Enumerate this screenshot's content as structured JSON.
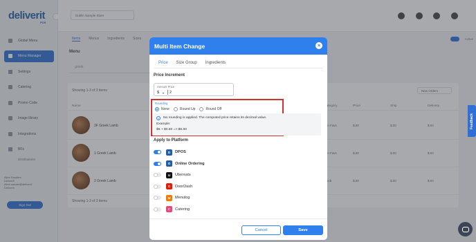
{
  "background": {
    "logo": "deliverit",
    "logo_sub": "POS",
    "store_select": "Dublin Sample Store",
    "nav": [
      {
        "label": "Global Menu",
        "icon": "globe-icon"
      },
      {
        "label": "Menu Manager",
        "icon": "menu-icon"
      },
      {
        "label": "Settings",
        "icon": "gear-icon"
      },
      {
        "label": "Catering",
        "icon": "catering-icon"
      },
      {
        "label": "Promo Code",
        "icon": "promo-icon"
      },
      {
        "label": "Image library",
        "icon": "image-icon"
      },
      {
        "label": "Integrations",
        "icon": "plug-icon"
      },
      {
        "label": "BFs",
        "icon": "report-icon"
      }
    ],
    "nav_sub": "Distributions",
    "account": [
      "Alice Sanders",
      "DeliverIt",
      "Alice.sander@deliverit",
      "DeliverIt"
    ],
    "signout": "Sign Out",
    "tabs": [
      "Items",
      "Menus",
      "Ingredients",
      "Sizes"
    ],
    "toggle_label": "Active",
    "menu_title": "Menu",
    "search_value": "greek",
    "showing_top": "Showing 1-3 of 3 items",
    "showing_bottom": "Showing 1-3 of 3 items",
    "ordering_select": "New Orders",
    "columns": [
      "Name",
      "Category",
      "Price",
      "Ship",
      "Delivery"
    ],
    "rows": [
      {
        "name": "3F Greek Lamb",
        "category": "Fan Favs",
        "price": "$.00",
        "ship": "$.00",
        "delivery": "$.00"
      },
      {
        "name": "1 Greek Lamb",
        "category": "Fan Favs",
        "price": "$.00",
        "ship": "$.00",
        "delivery": "$.00"
      },
      {
        "name": "2 Greek Lamb",
        "category": "Lamb",
        "price": "$.00",
        "ship": "$.00",
        "delivery": "$.00"
      }
    ]
  },
  "modal": {
    "title": "Multi Item Change",
    "close_icon": "close-icon",
    "tabs": [
      {
        "label": "Price",
        "active": true
      },
      {
        "label": "Size Group",
        "active": false
      },
      {
        "label": "Ingredients",
        "active": false
      }
    ],
    "price_increment_title": "Price Increment",
    "amount": {
      "label": "Amount Price",
      "currency": "$",
      "currency_caret": "▾",
      "value": "2"
    },
    "rounding": {
      "label": "Rounding",
      "options": [
        {
          "label": "None",
          "selected": true
        },
        {
          "label": "Round Up",
          "selected": false
        },
        {
          "label": "Round Off",
          "selected": false
        }
      ],
      "info_icon": "info-icon",
      "info_text": "No rounding is applied. The computed price retains its decimal value.",
      "example_label": "Example:",
      "example_value": "$6 + $0.60 => $6.60"
    },
    "apply_title": "Apply to Platform",
    "platforms": [
      {
        "name": "DPOS",
        "enabled": true,
        "icon": "dpos-icon",
        "color": "#1f5fa8",
        "glyph": "D"
      },
      {
        "name": "Online Ordering",
        "enabled": true,
        "icon": "online-ordering-icon",
        "color": "#1f5fa8",
        "glyph": "O"
      },
      {
        "name": "Ubereats",
        "enabled": false,
        "icon": "ubereats-icon",
        "color": "#111111",
        "glyph": "U"
      },
      {
        "name": "DoorDash",
        "enabled": false,
        "icon": "doordash-icon",
        "color": "#eb1700",
        "glyph": "D"
      },
      {
        "name": "Menulog",
        "enabled": false,
        "icon": "menulog-icon",
        "color": "#f27c00",
        "glyph": "M"
      },
      {
        "name": "Catering",
        "enabled": false,
        "icon": "catering-icon",
        "color": "#e8487a",
        "glyph": "C"
      }
    ],
    "cancel_label": "Cancel",
    "save_label": "Save"
  },
  "feedback_label": "Feedback",
  "accent_color": "#2f80ed",
  "highlight_color": "#d32f2f"
}
